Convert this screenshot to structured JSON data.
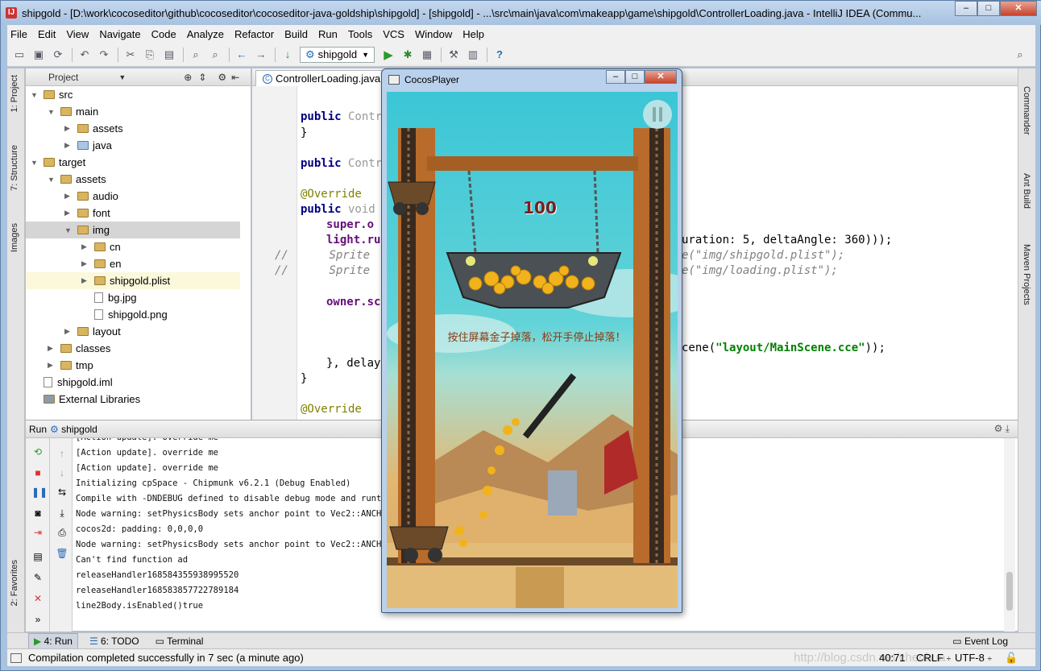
{
  "window": {
    "title": "shipgold - [D:\\work\\cocoseditor\\github\\cocoseditor\\cocoseditor-java-goldship\\shipgold] - [shipgold] - ...\\src\\main\\java\\com\\makeapp\\game\\shipgold\\ControllerLoading.java - IntelliJ IDEA (Commu..."
  },
  "menu": [
    "File",
    "Edit",
    "View",
    "Navigate",
    "Code",
    "Analyze",
    "Refactor",
    "Build",
    "Run",
    "Tools",
    "VCS",
    "Window",
    "Help"
  ],
  "toolbar": {
    "run_config": "shipgold"
  },
  "left_tabs": {
    "project": "1: Project",
    "structure": "7: Structure",
    "images": "Images",
    "favorites": "2: Favorites"
  },
  "right_tabs": {
    "commander": "Commander",
    "ant": "Ant Build",
    "maven": "Maven Projects"
  },
  "project": {
    "header": "Project",
    "tree": [
      {
        "label": "src",
        "depth": 0,
        "arrow": "▼",
        "kind": "folder"
      },
      {
        "label": "main",
        "depth": 1,
        "arrow": "▼",
        "kind": "folder"
      },
      {
        "label": "assets",
        "depth": 2,
        "arrow": "▶",
        "kind": "folder"
      },
      {
        "label": "java",
        "depth": 2,
        "arrow": "▶",
        "kind": "folder-blue"
      },
      {
        "label": "target",
        "depth": 0,
        "arrow": "▼",
        "kind": "folder"
      },
      {
        "label": "assets",
        "depth": 1,
        "arrow": "▼",
        "kind": "folder"
      },
      {
        "label": "audio",
        "depth": 2,
        "arrow": "▶",
        "kind": "folder"
      },
      {
        "label": "font",
        "depth": 2,
        "arrow": "▶",
        "kind": "folder"
      },
      {
        "label": "img",
        "depth": 2,
        "arrow": "▼",
        "kind": "folder",
        "selected": true
      },
      {
        "label": "cn",
        "depth": 3,
        "arrow": "▶",
        "kind": "folder"
      },
      {
        "label": "en",
        "depth": 3,
        "arrow": "▶",
        "kind": "folder"
      },
      {
        "label": "shipgold.plist",
        "depth": 3,
        "arrow": "▶",
        "kind": "folder",
        "highlight": true
      },
      {
        "label": "bg.jpg",
        "depth": 3,
        "arrow": "",
        "kind": "file"
      },
      {
        "label": "shipgold.png",
        "depth": 3,
        "arrow": "",
        "kind": "file"
      },
      {
        "label": "layout",
        "depth": 2,
        "arrow": "▶",
        "kind": "folder"
      },
      {
        "label": "classes",
        "depth": 1,
        "arrow": "▶",
        "kind": "folder"
      },
      {
        "label": "tmp",
        "depth": 1,
        "arrow": "▶",
        "kind": "folder"
      },
      {
        "label": "shipgold.iml",
        "depth": 0,
        "arrow": "",
        "kind": "file"
      },
      {
        "label": "External Libraries",
        "depth": 0,
        "arrow": "",
        "kind": "lib"
      }
    ]
  },
  "editor": {
    "tab": "ControllerLoading.java",
    "lines": [
      {
        "k": "public",
        "r": " Contr"
      },
      {
        "p": "}"
      },
      {
        "k": "public",
        "r": " Contr"
      },
      {
        "a": "@Override"
      },
      {
        "k": "public",
        "r": " void"
      },
      {
        "f": "super.o"
      },
      {
        "f": "light.ru",
        "tail": "uration: 5, deltaAngle: 360)));"
      },
      {
        "c": "//      Sprite",
        "tail": "e(\"img/shipgold.plist\");"
      },
      {
        "c": "//      Sprite",
        "tail": "e(\"img/loading.plist\");"
      },
      {
        "f": "owner.sc"
      },
      {
        "p": "}, delay"
      },
      {
        "p": "}"
      },
      {
        "a": "@Override"
      }
    ],
    "scene_tail_pre": "cene(",
    "scene_tail_str": "\"layout/MainScene.cce\"",
    "scene_tail_post": "));"
  },
  "run": {
    "label": "Run",
    "config": "shipgold",
    "console": [
      "[Action update]. override me",
      "[Action update]. override me",
      "[Action update]. override me",
      "Initializing cpSpace - Chipmunk v6.2.1 (Debug Enabled)",
      "Compile with -DNDEBUG defined to disable debug mode and runtim",
      "Node warning: setPhysicsBody sets anchor point to Vec2::ANCHOR",
      "cocos2d: padding: 0,0,0,0",
      "Node warning: setPhysicsBody sets anchor point to Vec2::ANCHOR",
      "Can't find function ad",
      "releaseHandler168584355938995520",
      "releaseHandler168583857722789184",
      "line2Body.isEnabled()true"
    ]
  },
  "bottom_tabs": [
    "4: Run",
    "6: TODO",
    "Terminal"
  ],
  "event_log": "Event Log",
  "status": {
    "message": "Compilation completed successfully in 7 sec (a minute ago)",
    "position": "40:71",
    "line_sep": "CRLF",
    "encoding": "UTF-8",
    "watermark": "http://blog.csdn.net/chenhua"
  },
  "cocos": {
    "title": "CocosPlayer",
    "score": "100",
    "hint": "按住屏幕金子掉落，松开手停止掉落！"
  },
  "colors": {
    "accent": "#3bc6d6",
    "gold": "#f1b31c",
    "wood": "#b86b2a"
  }
}
